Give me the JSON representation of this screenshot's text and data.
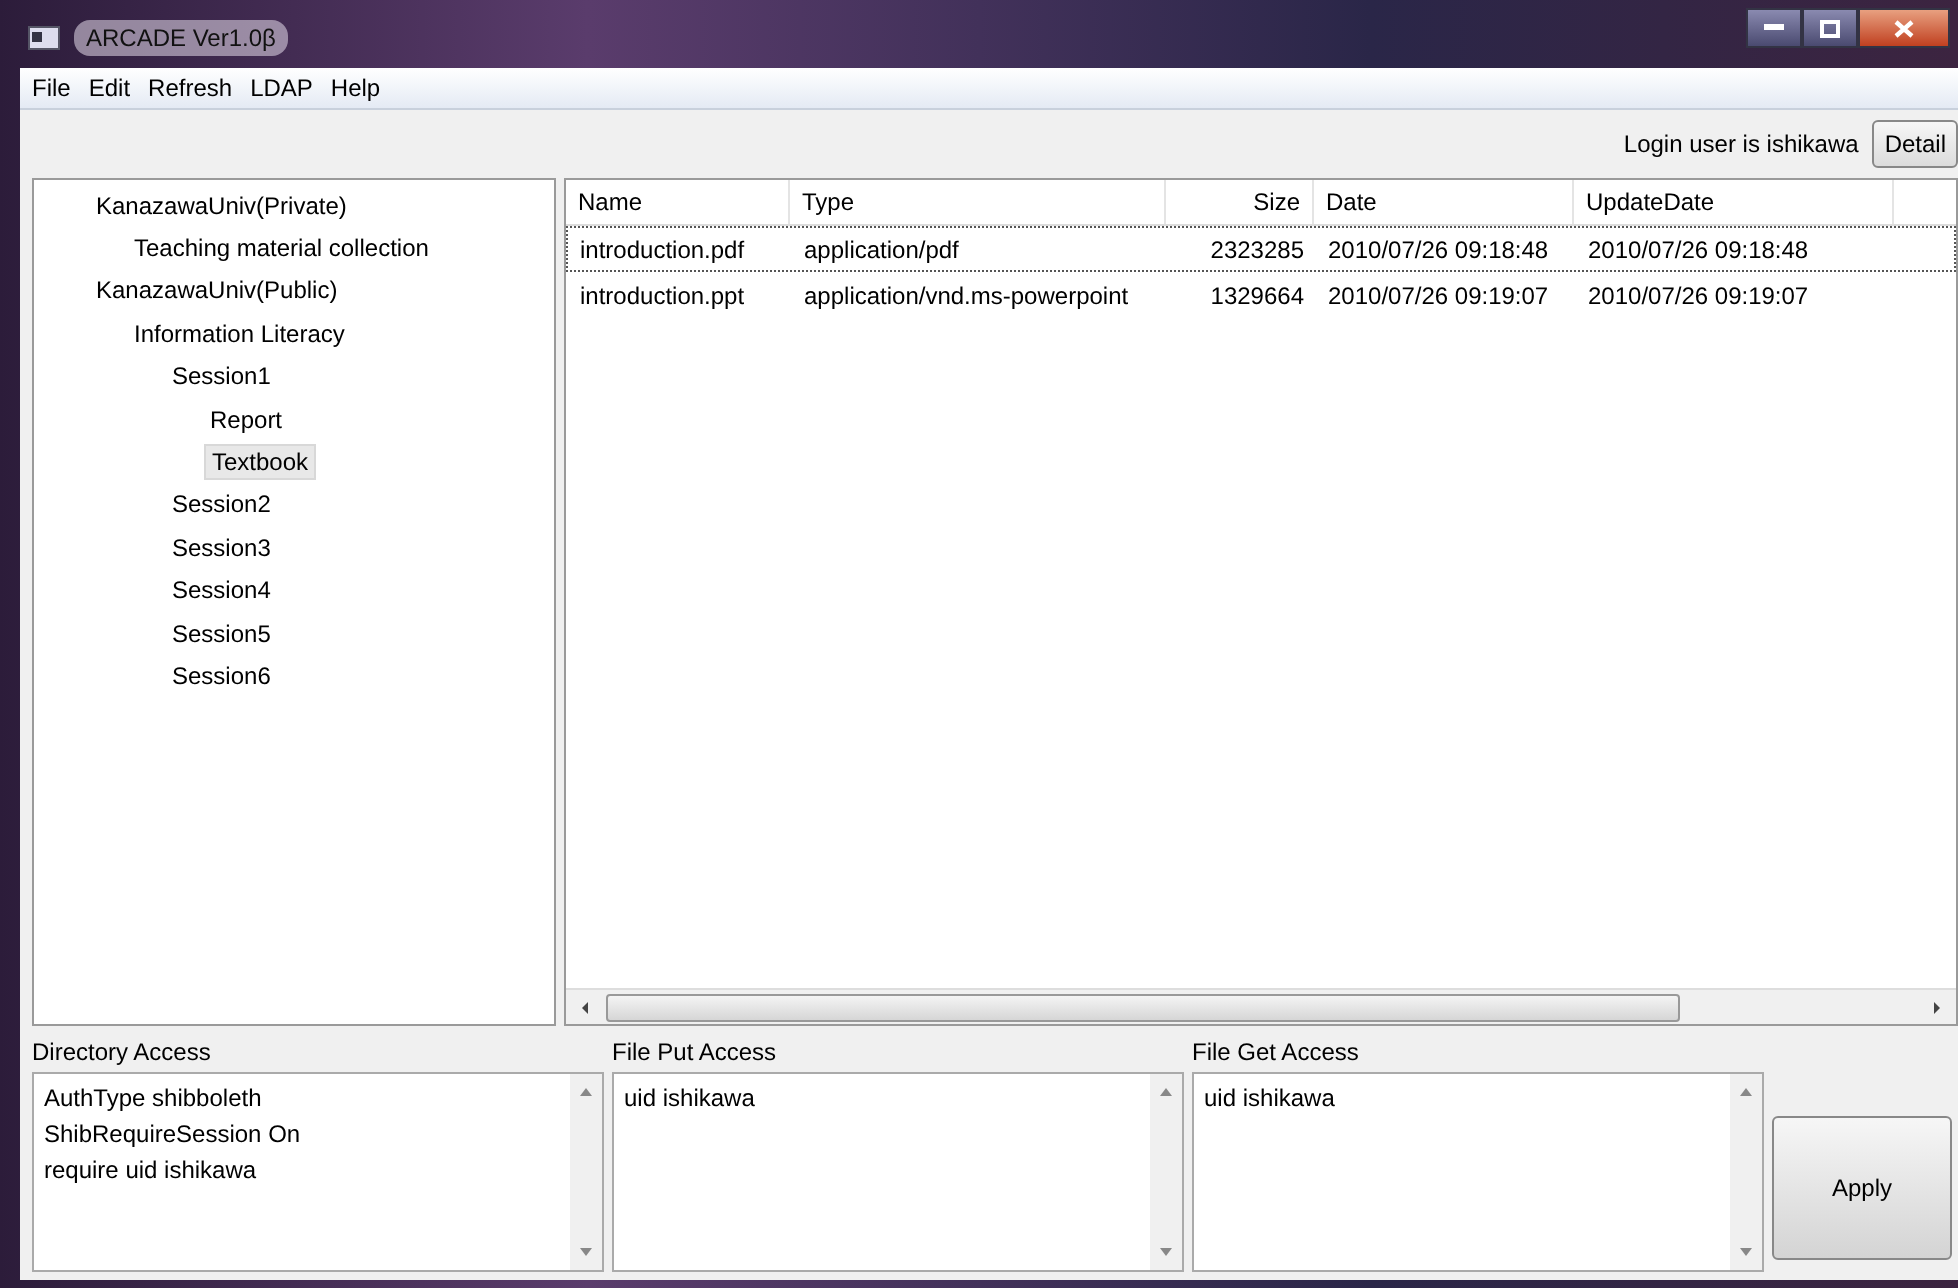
{
  "window": {
    "title": "ARCADE Ver1.0β"
  },
  "menu": [
    "File",
    "Edit",
    "Refresh",
    "LDAP",
    "Help"
  ],
  "toolbar": {
    "login_text": "Login user is ishikawa",
    "detail_button": "Detail"
  },
  "tree": [
    {
      "label": "KanazawaUniv(Private)",
      "selected": false,
      "children": [
        {
          "label": "Teaching material collection",
          "selected": false
        }
      ]
    },
    {
      "label": "KanazawaUniv(Public)",
      "selected": false,
      "children": [
        {
          "label": "Information Literacy",
          "selected": false,
          "children": [
            {
              "label": "Session1",
              "selected": false,
              "children": [
                {
                  "label": "Report",
                  "selected": false
                },
                {
                  "label": "Textbook",
                  "selected": true
                }
              ]
            },
            {
              "label": "Session2",
              "selected": false
            },
            {
              "label": "Session3",
              "selected": false
            },
            {
              "label": "Session4",
              "selected": false
            },
            {
              "label": "Session5",
              "selected": false
            },
            {
              "label": "Session6",
              "selected": false
            }
          ]
        }
      ]
    }
  ],
  "table": {
    "columns": [
      "Name",
      "Type",
      "Size",
      "Date",
      "UpdateDate"
    ],
    "rows": [
      {
        "cells": [
          "introduction.pdf",
          "application/pdf",
          "2323285",
          "2010/07/26 09:18:48",
          "2010/07/26 09:18:48"
        ],
        "focused": true
      },
      {
        "cells": [
          "introduction.ppt",
          "application/vnd.ms-powerpoint",
          "1329664",
          "2010/07/26 09:19:07",
          "2010/07/26 09:19:07"
        ],
        "focused": false
      }
    ]
  },
  "access": [
    {
      "label": "Directory Access",
      "value": "AuthType shibboleth\nShibRequireSession On\nrequire uid ishikawa"
    },
    {
      "label": "File Put Access",
      "value": "uid ishikawa"
    },
    {
      "label": "File Get Access",
      "value": "uid ishikawa"
    }
  ],
  "apply_button": "Apply"
}
